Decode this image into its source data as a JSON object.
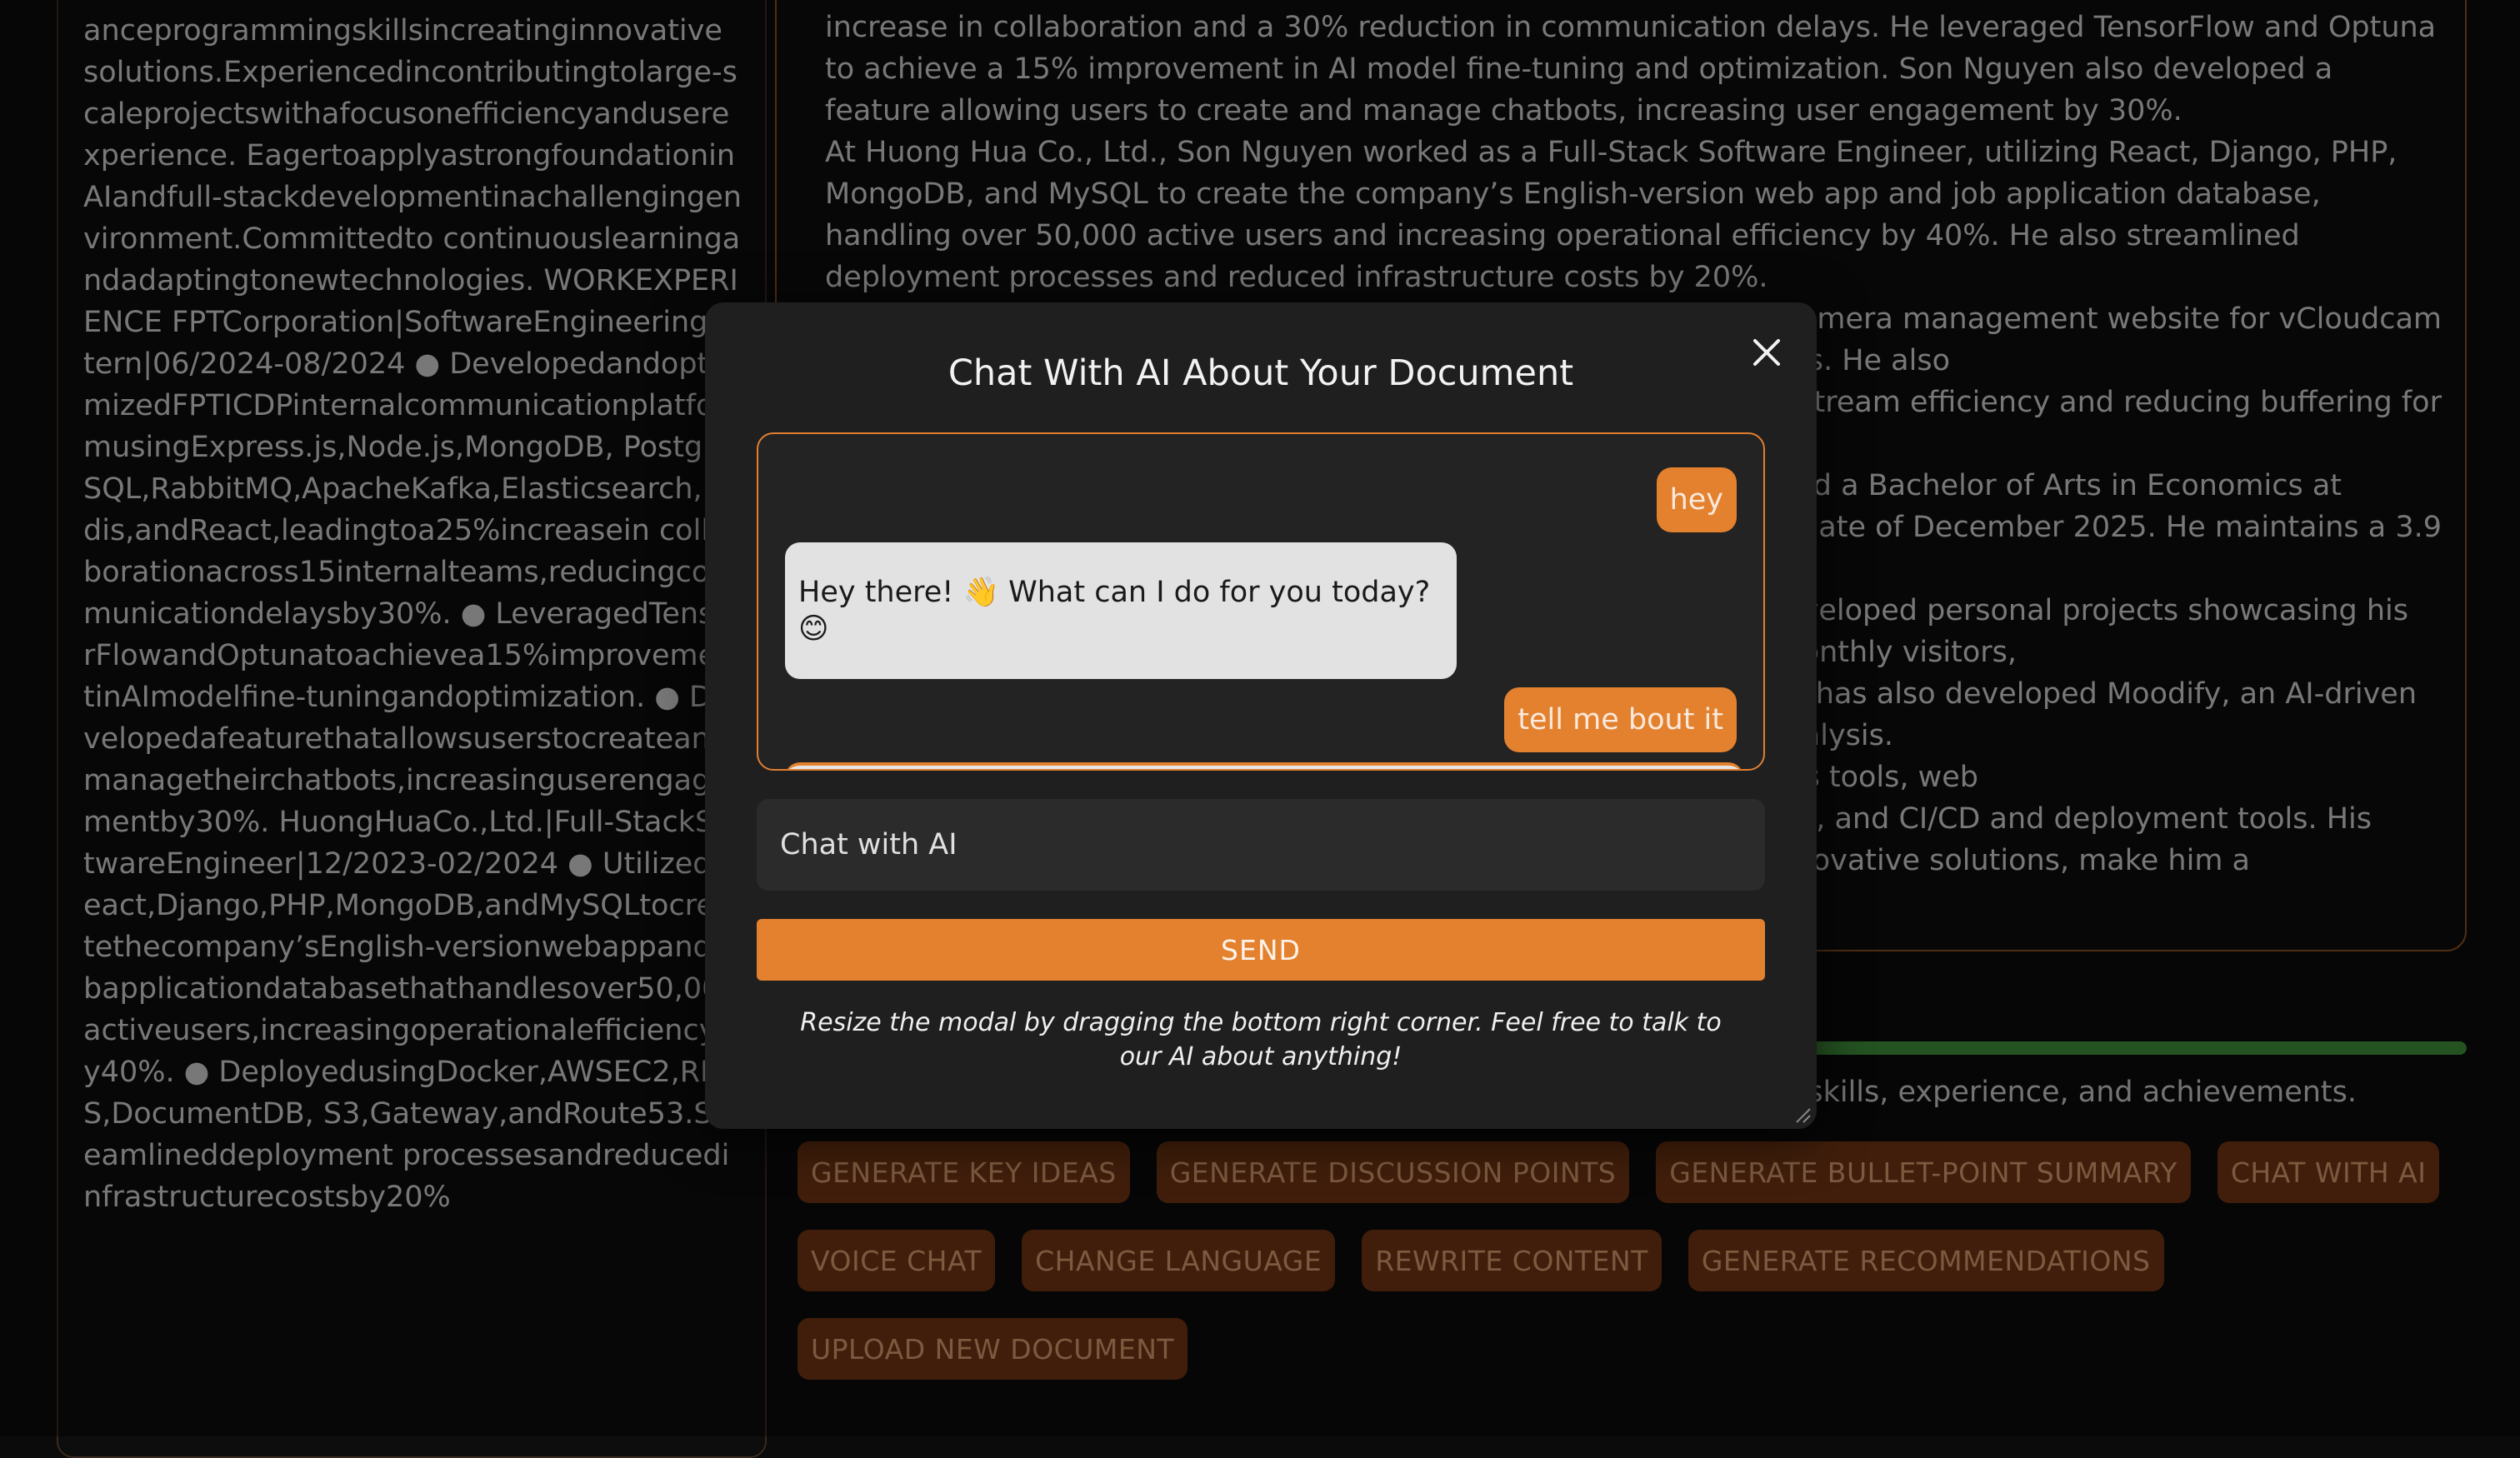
{
  "document": {
    "text": "anceprogrammingskillsincreatinginnovative solutions.Experiencedincontributingtolarge-scaleprojectswithafocusonefficiencyanduserexperience. Eagertoapplyastrongfoundationin AIandfull-stackdevelopmentinachallengingenvironment.Committedto continuouslearningandadaptingtonewtechnologies. WORKEXPERIENCE FPTCorporation|SoftwareEngineeringIntern|06/2024-08/2024 ● DevelopedandoptimizedFPTICDPinternalcommunicationplatformusingExpress.js,Node.js,MongoDB, PostgreSQL,RabbitMQ,ApacheKafka,Elasticsearch,Redis,andReact,leadingtoa25%increasein collaborationacross15internalteams,reducingcommunicationdelaysby30%. ● LeveragedTensorFlowandOptunatoachievea15%improvementinAImodelfine-tuningandoptimization. ● Developedafeaturethatallowsuserstocreateandmanagetheirchatbots,increasinguserengagementby30%. HuongHuaCo.,Ltd.|Full-StackSoftwareEngineer|12/2023-02/2024 ● UtilizedReact,Django,PHP,MongoDB,andMySQLtocreatethecompany’sEnglish-versionwebappandjobapplicationdatabasethathandlesover50,000 activeusers,increasingoperationalefficiencyby40%. ● DeployedusingDocker,AWSEC2,RDS,DocumentDB, S3,Gateway,andRoute53.Streamlineddeployment processesandreducedinfrastructurecostsby20%"
  },
  "summary": {
    "paragraphs": [
      "increase in collaboration and a 30% reduction in communication delays. He leveraged TensorFlow and Optuna to achieve a 15% improvement in AI model fine-tuning and optimization. Son Nguyen also developed a feature allowing users to create and manage chatbots, increasing user engagement by 30%.",
      "At Huong Hua Co., Ltd., Son Nguyen worked as a Full-Stack Software Engineer, utilizing React, Django, PHP, MongoDB, and MySQL to create the company’s English-version web app and job application database, handling over 50,000 active users and increasing operational efficiency by 40%. He also streamlined deployment processes and reduced infrastructure costs by 20%.",
      "camera management website for vCloudcam",
      "ng over 50,000 monthly visits. He also",
      "a stream efficiency and reducing buffering for",
      "nce and a Bachelor of Arts in Economics at",
      "on date of December 2025. He maintains a 3.9",
      "e developed personal projects showcasing his",
      "pports over 420,000 monthly visitors,",
      ". He has also developed Moodify, an AI-driven",
      "ent analysis.",
      "abases, data analytics tools, web",
      "orms, and CI/CD and deployment tools. His",
      "ng and innovative solutions, make him a"
    ]
  },
  "progress": {
    "percent": 100,
    "color": "#3f8e3a"
  },
  "analysis_caption": "ng skills, experience, and achievements.",
  "actions": {
    "row1": [
      "GENERATE KEY IDEAS",
      "GENERATE DISCUSSION POINTS",
      "GENERATE BULLET-POINT SUMMARY",
      "CHAT WITH AI"
    ],
    "row2": [
      "VOICE CHAT",
      "CHANGE LANGUAGE",
      "REWRITE CONTENT",
      "GENERATE RECOMMENDATIONS"
    ],
    "row3": [
      "UPLOAD NEW DOCUMENT"
    ]
  },
  "modal": {
    "title": "Chat With AI About Your Document",
    "close_icon": "close-icon",
    "messages": [
      {
        "role": "user",
        "text": "hey"
      },
      {
        "role": "ai",
        "text": "Hey there! 👋 What can I do for you today? 😊"
      },
      {
        "role": "user",
        "text": "tell me bout it"
      }
    ],
    "input_placeholder": "Chat with AI",
    "send_label": "SEND",
    "hint": "Resize the modal by dragging the bottom right corner. Feel free to talk to our AI about anything!"
  },
  "colors": {
    "accent": "#e3812f",
    "button_bg": "#6e3513",
    "button_text": "#d69a6d",
    "modal_bg": "#1f1f1f"
  }
}
